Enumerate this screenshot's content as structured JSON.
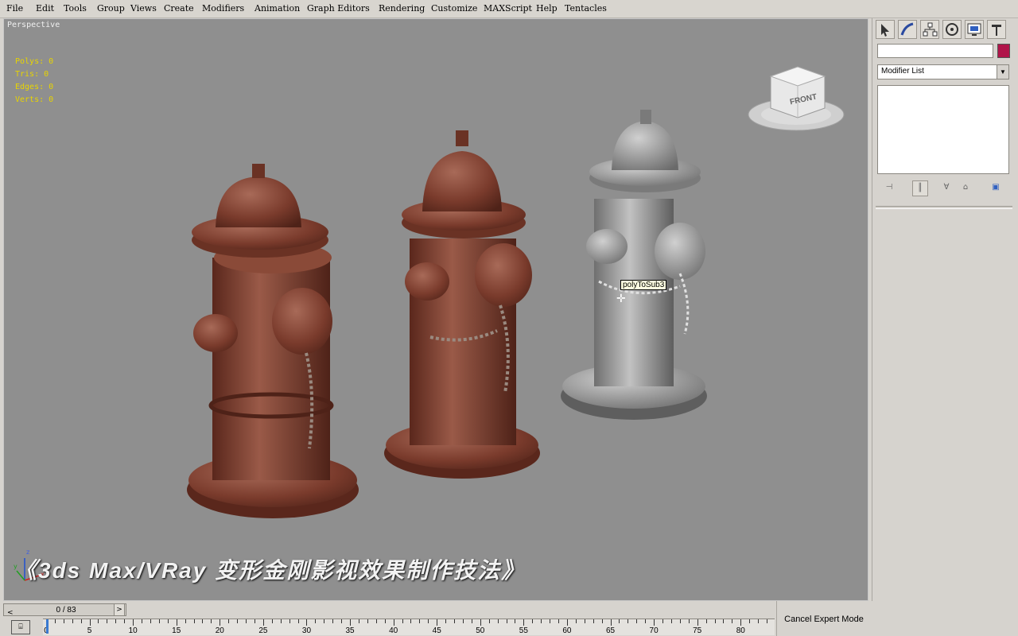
{
  "menu": [
    "File",
    "Edit",
    "Tools",
    "Group",
    "Views",
    "Create",
    "Modifiers",
    "Animation",
    "Graph Editors",
    "Rendering",
    "Customize",
    "MAXScript",
    "Help",
    "Tentacles"
  ],
  "viewport": {
    "label": "Perspective",
    "stats": {
      "polys": "Polys: 0",
      "tris": "Tris:  0",
      "edges": "Edges: 0",
      "verts": "Verts: 0"
    },
    "viewcube_label": "FRONT",
    "tooltip": "polyToSub3",
    "overlay_title": "《3ds Max/VRay 变形金刚影视效果制作技法》",
    "axis_labels": {
      "x": "x",
      "y": "y",
      "z": "z"
    }
  },
  "command_panel": {
    "tab_icons": [
      "create-icon",
      "modify-icon",
      "hierarchy-icon",
      "motion-icon",
      "display-icon",
      "utilities-icon"
    ],
    "name_value": "",
    "color": "#b0154a",
    "modifier_list": "Modifier List"
  },
  "timeline": {
    "slider_label": "0 / 83",
    "ticks": [
      "0",
      "5",
      "10",
      "15",
      "20",
      "25",
      "30",
      "35",
      "40",
      "45",
      "50",
      "55",
      "60",
      "65",
      "70",
      "75",
      "80"
    ],
    "cancel_expert": "Cancel Expert Mode"
  },
  "colors": {
    "rust": "#7a3b2c",
    "grey_model": "#9a9a9a",
    "viewport_bg": "#8f8f8f"
  }
}
